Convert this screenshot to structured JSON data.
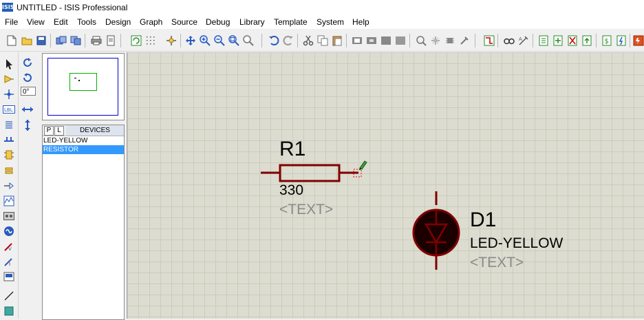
{
  "window": {
    "app_icon_text": "ISIS",
    "title": "UNTITLED - ISIS Professional"
  },
  "menu": {
    "items": [
      "File",
      "View",
      "Edit",
      "Tools",
      "Design",
      "Graph",
      "Source",
      "Debug",
      "Library",
      "Template",
      "System",
      "Help"
    ]
  },
  "rotation": {
    "angle": "0°"
  },
  "selector": {
    "tab_p": "P",
    "tab_l": "L",
    "title": "DEVICES",
    "devices": [
      "LED-YELLOW",
      "RESISTOR"
    ],
    "selected_index": 1
  },
  "schematic": {
    "resistor": {
      "ref": "R1",
      "value": "330",
      "text": "<TEXT>"
    },
    "led": {
      "ref": "D1",
      "value": "LED-YELLOW",
      "text": "<TEXT>"
    }
  },
  "colors": {
    "wire": "#800000",
    "led_fill": "#1a0000",
    "canvas": "#dcdcd0",
    "selection": "#3399ff"
  }
}
